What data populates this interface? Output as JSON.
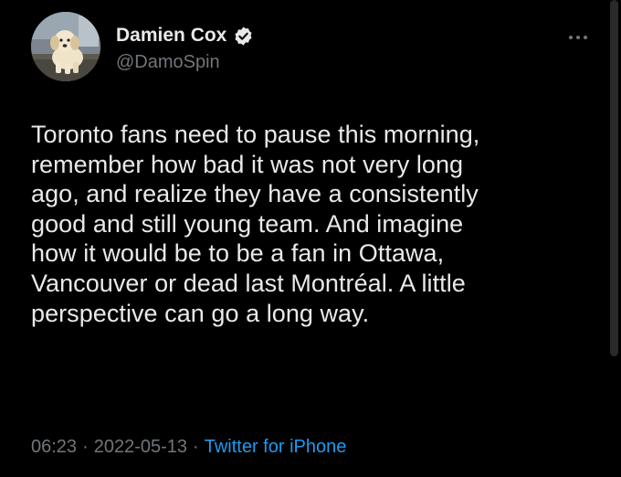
{
  "author": {
    "display_name": "Damien Cox",
    "handle": "@DamoSpin",
    "verified": true,
    "avatar_icon": "puppy-photo-avatar"
  },
  "tweet": {
    "lines": [
      "Toronto fans need to pause this morning,",
      "remember how bad it was not very long",
      "ago, and realize they have a consistently",
      "good and still young team. And imagine",
      "how it would be to be a fan in Ottawa,",
      "Vancouver or dead last Montréal. A little",
      "perspective can go a long way."
    ]
  },
  "meta": {
    "time": "06:23",
    "date": "2022-05-13",
    "separator": "·",
    "source": "Twitter for iPhone"
  },
  "icons": {
    "more": "more-options-icon",
    "verified": "verified-badge-icon"
  },
  "colors": {
    "background": "#000000",
    "text": "#e7e9ea",
    "secondary": "#71767b",
    "link": "#1d9bf0"
  }
}
